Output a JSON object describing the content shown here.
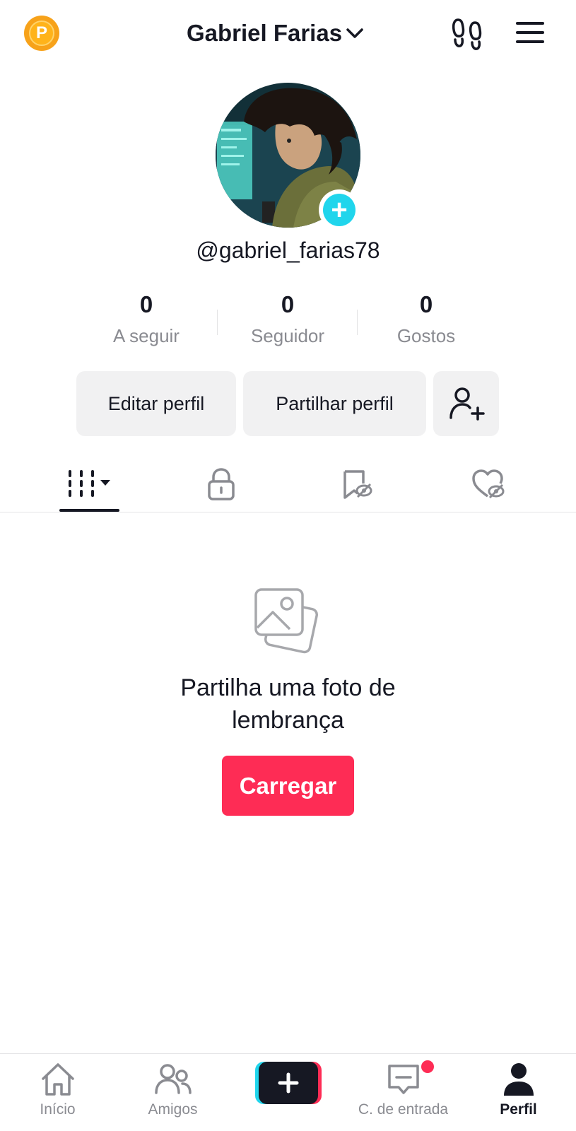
{
  "header": {
    "coin_letter": "P",
    "username_title": "Gabriel Farias"
  },
  "profile": {
    "handle": "@gabriel_farias78"
  },
  "stats": [
    {
      "value": "0",
      "label": "A seguir"
    },
    {
      "value": "0",
      "label": "Seguidor"
    },
    {
      "value": "0",
      "label": "Gostos"
    }
  ],
  "actions": {
    "edit_label": "Editar perfil",
    "share_label": "Partilhar perfil"
  },
  "tabs": [
    "grid-icon",
    "lock-icon",
    "bookmark-icon",
    "liked-icon"
  ],
  "empty_state": {
    "message": "Partilha uma foto de lembrança",
    "upload_label": "Carregar"
  },
  "bottom_nav": [
    {
      "label": "Início",
      "icon": "home-icon"
    },
    {
      "label": "Amigos",
      "icon": "friends-icon"
    },
    {
      "label": "",
      "icon": "create-plus-icon"
    },
    {
      "label": "C. de entrada",
      "icon": "inbox-icon"
    },
    {
      "label": "Perfil",
      "icon": "profile-icon"
    }
  ],
  "colors": {
    "accent": "#fe2c55",
    "cyan": "#20d5ec",
    "muted_text": "#8a8b91",
    "button_bg": "#f1f1f2"
  }
}
